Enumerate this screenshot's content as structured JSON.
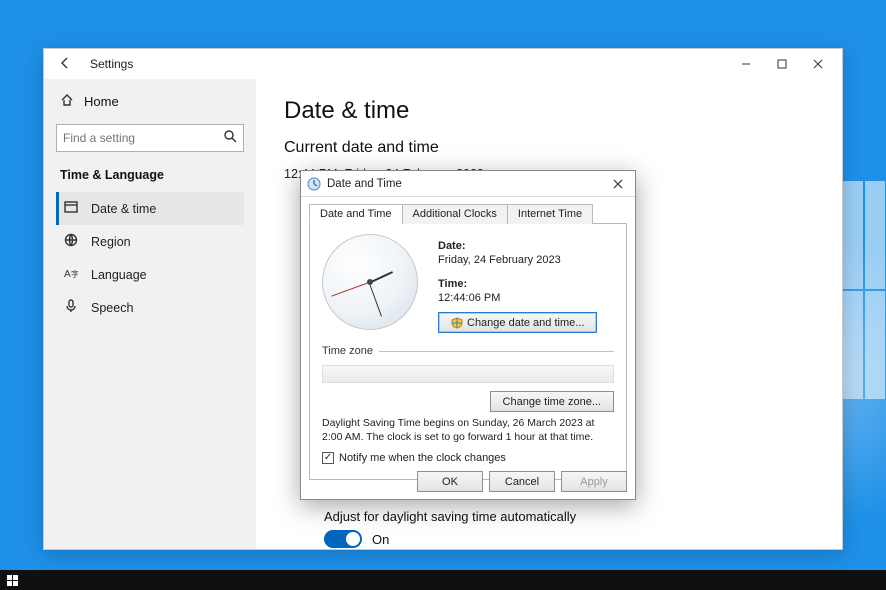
{
  "window": {
    "title": "Settings",
    "sidebar": {
      "home_label": "Home",
      "search_placeholder": "Find a setting",
      "section_label": "Time & Language",
      "items": [
        {
          "label": "Date & time",
          "icon": "calendar-clock-icon",
          "active": true
        },
        {
          "label": "Region",
          "icon": "globe-icon",
          "active": false
        },
        {
          "label": "Language",
          "icon": "language-icon",
          "active": false
        },
        {
          "label": "Speech",
          "icon": "microphone-icon",
          "active": false
        }
      ]
    },
    "content": {
      "heading": "Date & time",
      "subheading": "Current date and time",
      "current_dt": "12:44 PM, Friday, 24 February 2023",
      "dst_label": "Adjust for daylight saving time automatically",
      "dst_toggle_state": "On"
    }
  },
  "legacy_dialog": {
    "title": "Date and Time",
    "tabs": [
      "Date and Time",
      "Additional Clocks",
      "Internet Time"
    ],
    "active_tab": 0,
    "date_label": "Date:",
    "date_value": "Friday, 24 February 2023",
    "time_label": "Time:",
    "time_value": "12:44:06 PM",
    "change_dt_btn": "Change date and time...",
    "tz_heading": "Time zone",
    "change_tz_btn": "Change time zone...",
    "dst_text": "Daylight Saving Time begins on Sunday, 26 March 2023 at 2:00 AM. The clock is set to go forward 1 hour at that time.",
    "notify_checkbox_label": "Notify me when the clock changes",
    "notify_checked": true,
    "buttons": {
      "ok": "OK",
      "cancel": "Cancel",
      "apply": "Apply"
    }
  }
}
